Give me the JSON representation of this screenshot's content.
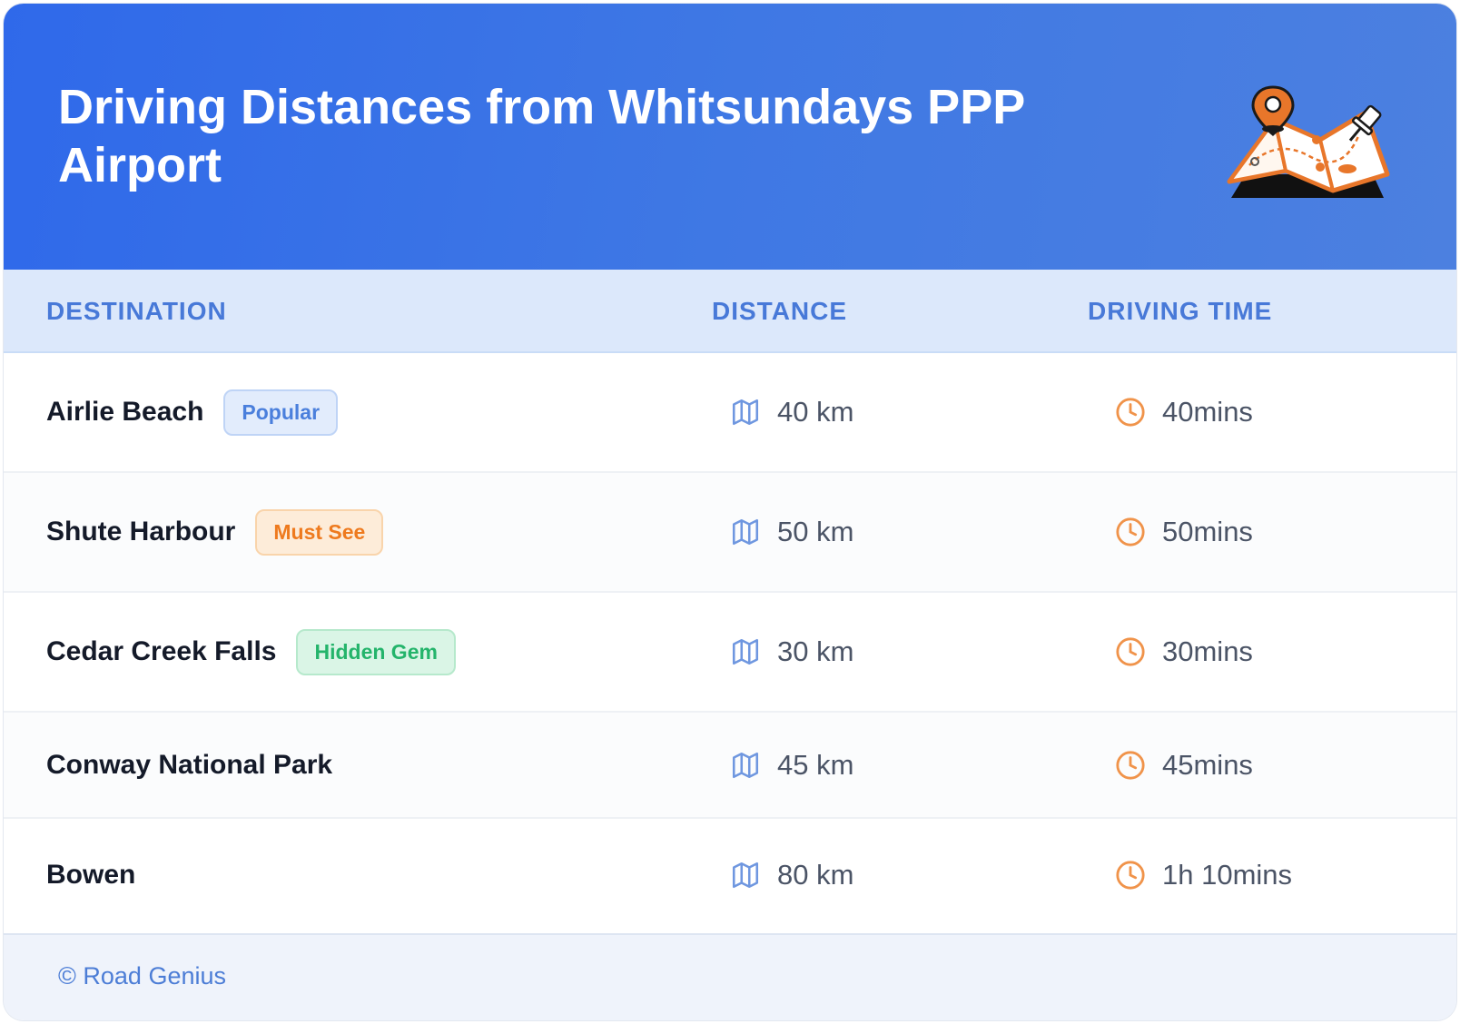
{
  "header": {
    "title": "Driving Distances from Whitsundays PPP Airport",
    "illustration": "map-pin-illustration"
  },
  "table": {
    "columns": [
      "DESTINATION",
      "DISTANCE",
      "DRIVING TIME"
    ],
    "rows": [
      {
        "destination": "Airlie Beach",
        "badge": "Popular",
        "distance": "40 km",
        "time": "40mins"
      },
      {
        "destination": "Shute Harbour",
        "badge": "Must See",
        "distance": "50 km",
        "time": "50mins"
      },
      {
        "destination": "Cedar Creek Falls",
        "badge": "Hidden Gem",
        "distance": "30 km",
        "time": "30mins"
      },
      {
        "destination": "Conway National Park",
        "distance": "45 km",
        "time": "45mins"
      },
      {
        "destination": "Bowen",
        "distance": "80 km",
        "time": "1h 10mins"
      }
    ]
  },
  "footer": {
    "text": "© Road Genius"
  },
  "colors": {
    "header_blue": "#2f69ea",
    "accent_orange": "#ee7a1e",
    "badge_blue": "#4a7fdc",
    "badge_orange": "#ee7a1e",
    "badge_green": "#24b46b"
  },
  "icons": {
    "distance": "map-icon",
    "time": "clock-icon"
  }
}
